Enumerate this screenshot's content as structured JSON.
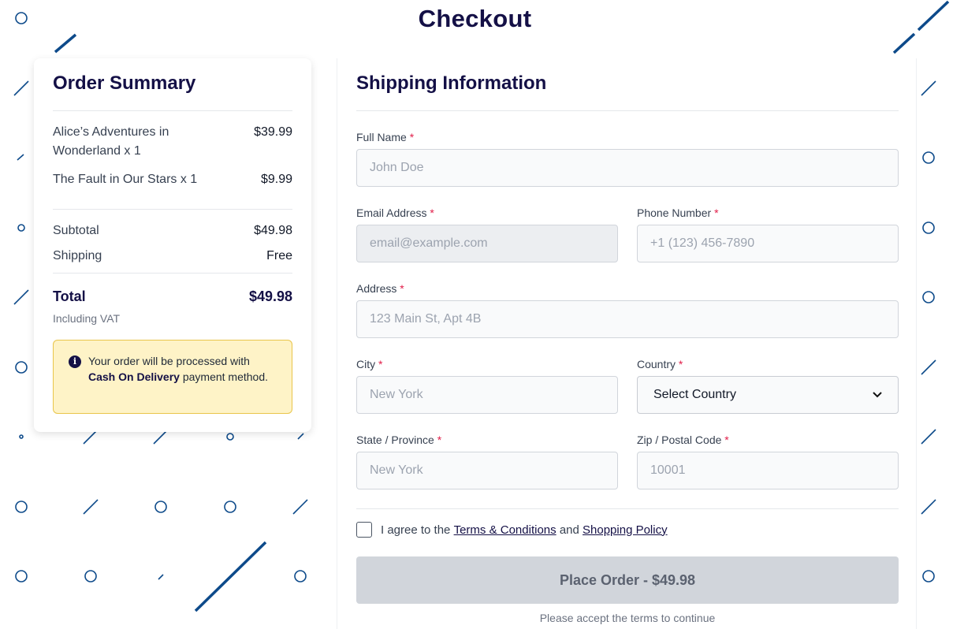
{
  "page": {
    "title": "Checkout"
  },
  "colors": {
    "accent": "#141046",
    "decor": "#0d4a8a",
    "notice_bg": "#fef3c7",
    "required": "#e11d48",
    "button_disabled": "#d1d5db"
  },
  "summary": {
    "title": "Order Summary",
    "items": [
      {
        "name": "Alice’s Adventures in Wonderland x 1",
        "price": "$39.99"
      },
      {
        "name": "The Fault in Our Stars x 1",
        "price": "$9.99"
      }
    ],
    "subtotal_label": "Subtotal",
    "subtotal_value": "$49.98",
    "shipping_label": "Shipping",
    "shipping_value": "Free",
    "total_label": "Total",
    "total_value": "$49.98",
    "vat_note": "Including VAT",
    "notice": {
      "icon": "info-icon",
      "prefix": "Your order will be processed with",
      "method": "Cash On Delivery",
      "suffix": "payment method."
    }
  },
  "shipping": {
    "title": "Shipping Information",
    "required_mark": "*",
    "full_name": {
      "label": "Full Name",
      "placeholder": "John Doe"
    },
    "email": {
      "label": "Email Address",
      "placeholder": "email@example.com"
    },
    "phone": {
      "label": "Phone Number",
      "placeholder": "+1 (123) 456-7890"
    },
    "address": {
      "label": "Address",
      "placeholder": "123 Main St, Apt 4B"
    },
    "city": {
      "label": "City",
      "placeholder": "New York"
    },
    "country": {
      "label": "Country",
      "selected": "Select Country"
    },
    "state": {
      "label": "State / Province",
      "placeholder": "New York"
    },
    "zip": {
      "label": "Zip / Postal Code",
      "placeholder": "10001"
    },
    "agree": {
      "prefix": "I agree to the",
      "terms_link": "Terms & Conditions",
      "and": "and",
      "policy_link": "Shopping Policy"
    },
    "button_label": "Place Order - $49.98",
    "hint": "Please accept the terms to continue"
  }
}
